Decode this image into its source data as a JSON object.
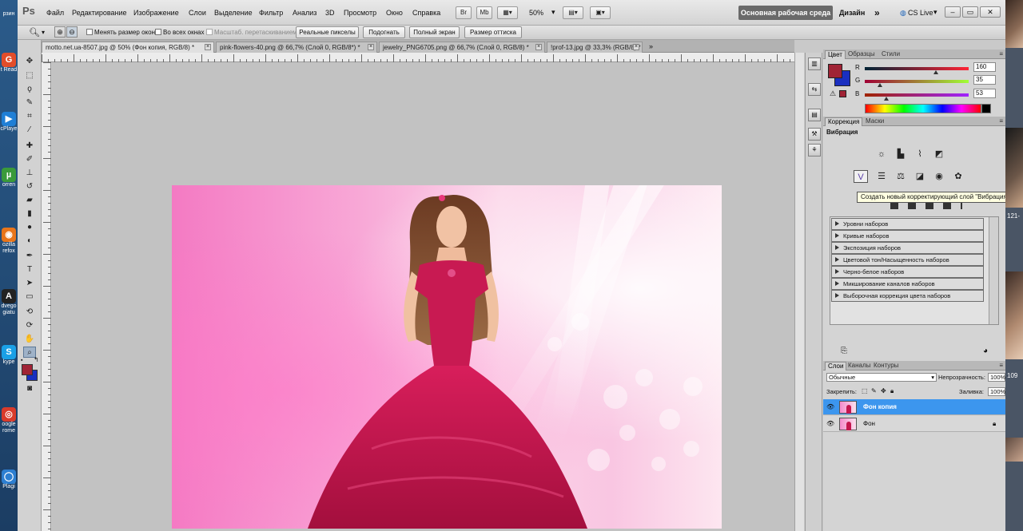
{
  "desktop_left": {
    "icons": [
      {
        "label": "рзин",
        "icon": "recycle-bin-icon"
      },
      {
        "label": "t Read",
        "icon": "pdf-reader-icon",
        "glyph": "G",
        "color": "#e24d2a"
      },
      {
        "label": "cPlaye",
        "icon": "media-player-icon",
        "glyph": "▶",
        "color": "#1f7fd6"
      },
      {
        "label": "orren",
        "icon": "utorrent-icon",
        "glyph": "µ",
        "color": "#3a9a3a"
      },
      {
        "label": "ozilla\nrefox",
        "icon": "firefox-icon",
        "glyph": "◉",
        "color": "#e8751a"
      },
      {
        "label": "dvego\ngiatu",
        "icon": "abbyy-icon",
        "glyph": "A",
        "color": "#222222"
      },
      {
        "label": "kype",
        "icon": "skype-icon",
        "glyph": "S",
        "color": "#1aa0e6"
      },
      {
        "label": "oogle\nrome",
        "icon": "chrome-icon",
        "glyph": "◎",
        "color": "#d83b2b"
      },
      {
        "label": "Plagi",
        "icon": "plagiarism-icon",
        "glyph": "◯",
        "color": "#2d7fd1"
      }
    ]
  },
  "desktop_right": {
    "texts": [
      "121-",
      "109"
    ]
  },
  "menubar": {
    "logo": "Ps",
    "items": [
      "Файл",
      "Редактирование",
      "Изображение",
      "Слои",
      "Выделение",
      "Фильтр",
      "Анализ",
      "3D",
      "Просмотр",
      "Окно",
      "Справка"
    ],
    "br_label": "Br",
    "mb_label": "Mb",
    "zoom": "50%",
    "workspace": "Основная рабочая среда",
    "design": "Дизайн",
    "more": "»",
    "cslive": "CS Live",
    "win_min": "–",
    "win_max": "▭",
    "win_close": "✕"
  },
  "options": {
    "resize_windows": "Менять размер окон",
    "all_windows": "Во всех окнах",
    "scrubby": "Масштаб. перетаскиванием",
    "actual_pixels": "Реальные пикселы",
    "fit_screen": "Подогнать",
    "full_screen": "Полный экран",
    "print_size": "Размер оттиска"
  },
  "doc_tabs": [
    "motto.net.ua-8507.jpg @ 50% (Фон копия, RGB/8) *",
    "pink-flowers-40.png @ 66,7% (Слой 0, RGB/8*) *",
    "jewelry_PNG6705.png @ 66,7% (Слой 0, RGB/8) *",
    "!prof-13.jpg @ 33,3% (RGB/8) *"
  ],
  "colors": {
    "foreground": "#a02335",
    "background": "#1a2fc0",
    "accent": "#3c96ee"
  },
  "color_panel": {
    "tabs": [
      "Цвет",
      "Образцы",
      "Стили"
    ],
    "r": {
      "label": "R",
      "value": "160"
    },
    "g": {
      "label": "G",
      "value": "35"
    },
    "b": {
      "label": "B",
      "value": "53"
    }
  },
  "adjust_panel": {
    "tabs": [
      "Коррекция",
      "Маски"
    ],
    "title": "Вибрация",
    "tooltip": "Создать новый корректирующий слой \"Вибрация\"",
    "presets": [
      "Уровни наборов",
      "Кривые наборов",
      "Экспозиция наборов",
      "Цветовой тон/Насыщенность наборов",
      "Черно-белое наборов",
      "Микширование каналов наборов",
      "Выборочная коррекция цвета наборов"
    ]
  },
  "layers_panel": {
    "tabs": [
      "Слои",
      "Каналы",
      "Контуры"
    ],
    "blend_mode": "Обычные",
    "opacity_label": "Непрозрачность:",
    "opacity": "100%",
    "lock_label": "Закрепить:",
    "fill_label": "Заливка:",
    "fill": "100%",
    "layers": [
      {
        "name": "Фон копия",
        "selected": true
      },
      {
        "name": "Фон",
        "selected": false
      }
    ]
  }
}
